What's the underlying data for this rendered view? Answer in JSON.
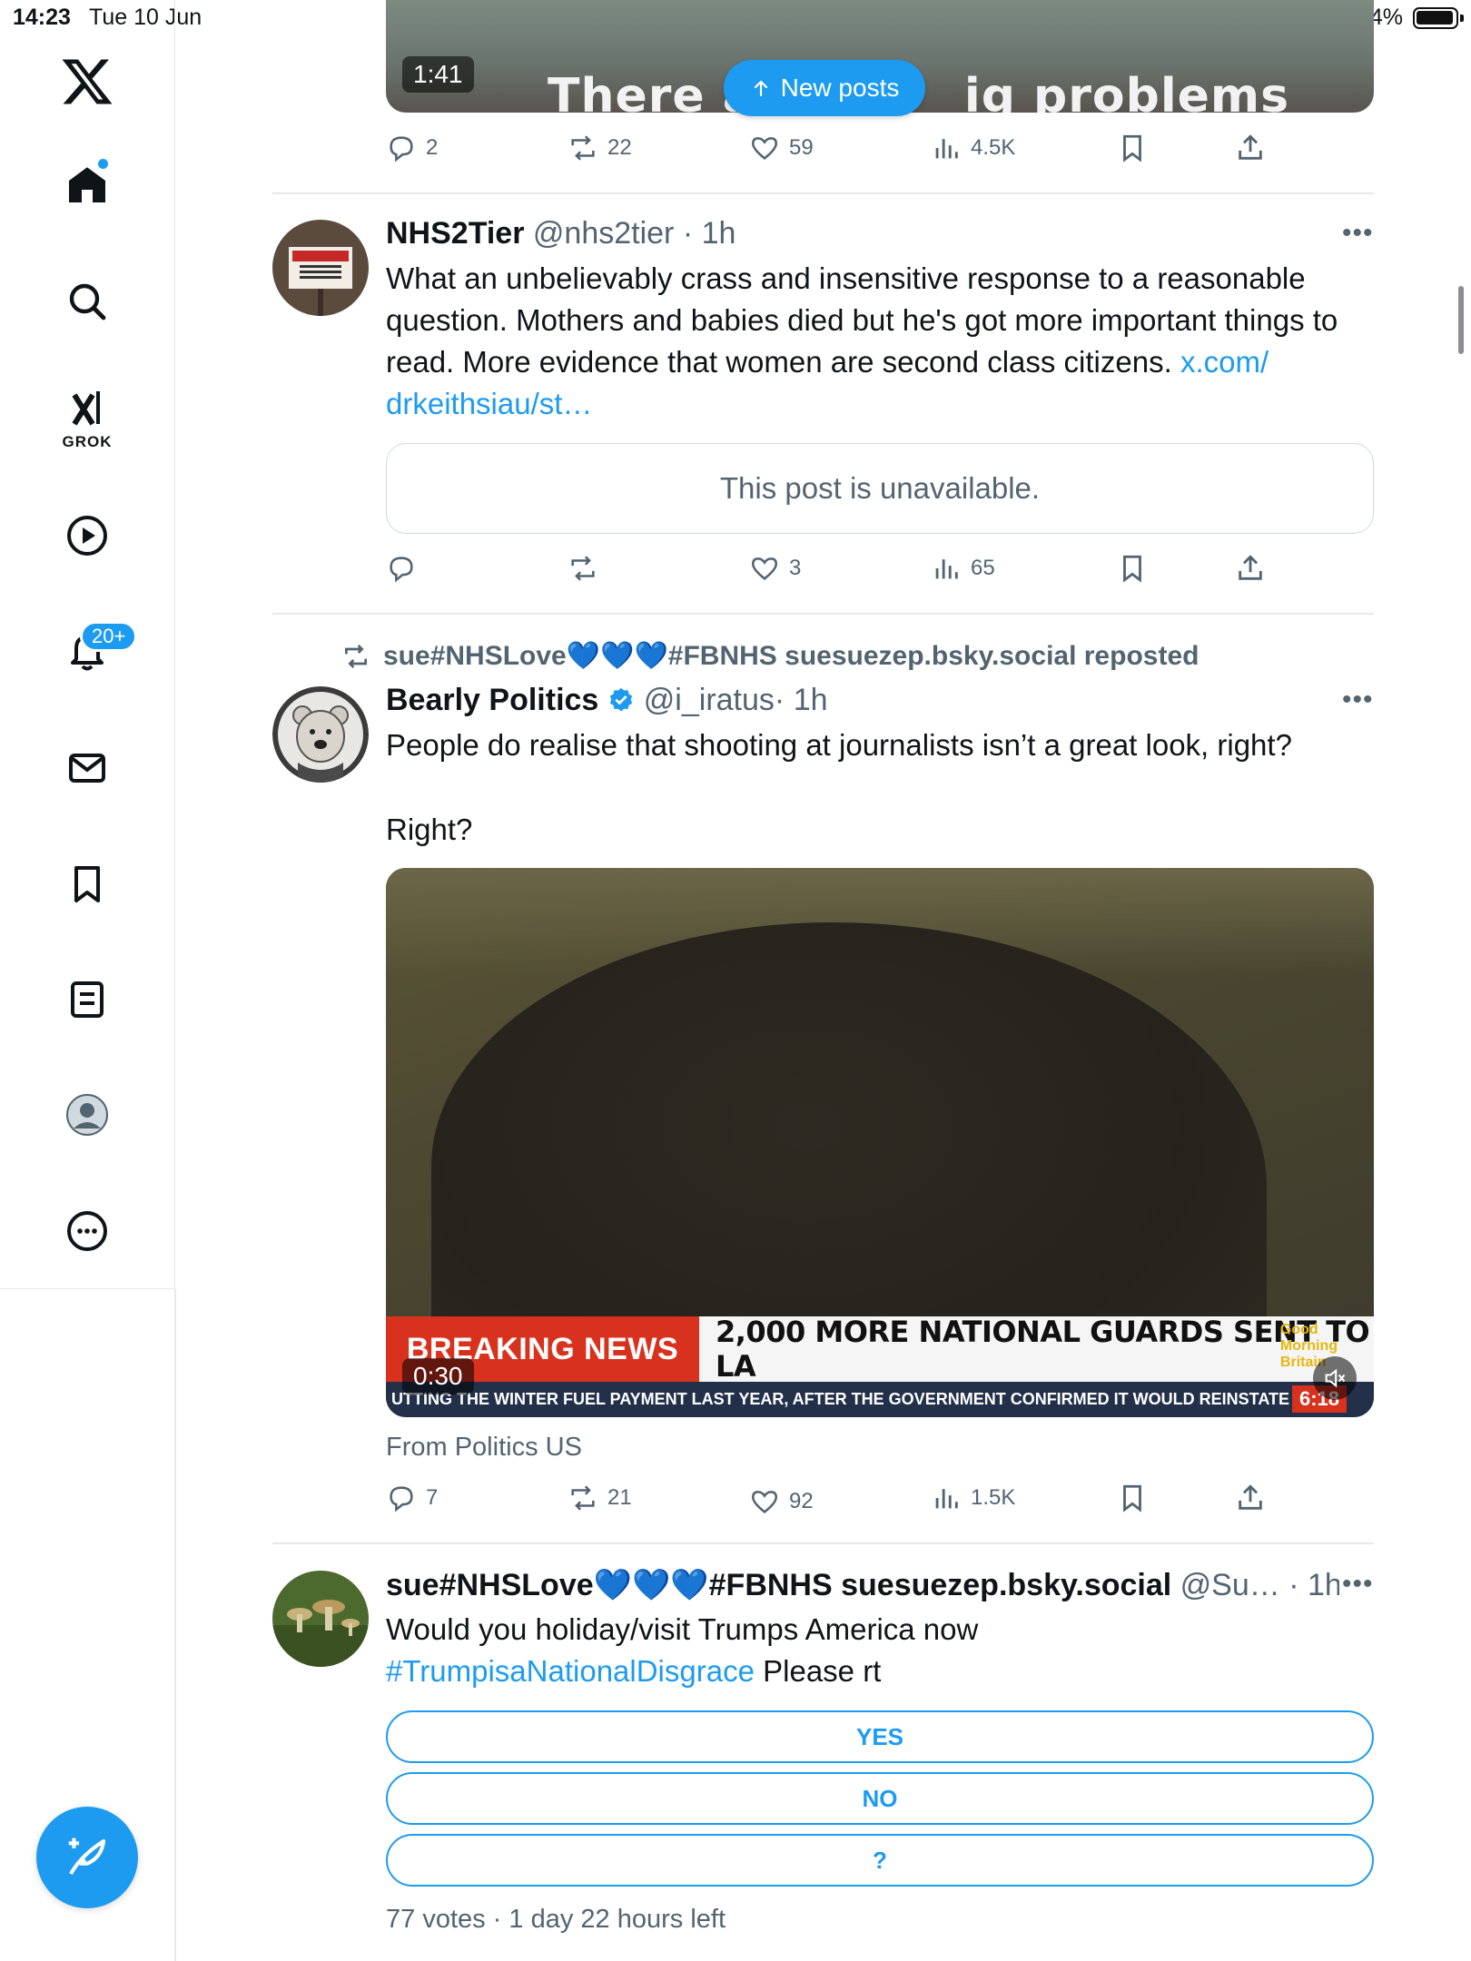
{
  "status_bar": {
    "time": "14:23",
    "date": "Tue 10 Jun",
    "battery": "94%"
  },
  "sidebar": {
    "items": [
      {
        "name": "home",
        "icon": "home-icon"
      },
      {
        "name": "explore",
        "icon": "search-icon"
      },
      {
        "name": "grok",
        "icon": "grok-icon",
        "label": "GROK"
      },
      {
        "name": "video",
        "icon": "play-circle-icon"
      },
      {
        "name": "notifications",
        "icon": "bell-icon",
        "badge": "20+"
      },
      {
        "name": "messages",
        "icon": "mail-icon"
      },
      {
        "name": "bookmarks",
        "icon": "bookmark-icon"
      },
      {
        "name": "lists",
        "icon": "list-icon"
      },
      {
        "name": "profile",
        "icon": "avatar-icon"
      },
      {
        "name": "more",
        "icon": "more-circle-icon"
      }
    ],
    "compose_icon": "compose-icon"
  },
  "new_posts_label": "New posts",
  "top_post": {
    "video_time": "1:41",
    "caption_visible": "There a",
    "caption_visible_2": "ig problems",
    "replies": "2",
    "reposts": "22",
    "likes": "59",
    "views": "4.5K"
  },
  "post1": {
    "name": "NHS2Tier",
    "handle": "@nhs2tier",
    "time": "· 1h",
    "text": "What an unbelievably crass and insensitive response to a reasonable question. Mothers and babies died but he's got more important things to read. More evidence that women are second class citizens.",
    "link_text": "x.com/drkeithsiau/st…",
    "link_part1": "x.com/",
    "link_part2": "drkeithsiau/st…",
    "quote_unavailable": "This post is unavailable.",
    "replies": "",
    "reposts": "",
    "likes": "3",
    "views": "65"
  },
  "post2": {
    "repost_by": "sue#NHSLove💙💙💙#FBNHS suesuezep.bsky.social reposted",
    "name": "Bearly Politics",
    "handle": "@i_iratus",
    "time": "· 1h",
    "text_line1": "People do realise that shooting at journalists isn’t a great look, right?",
    "text_line2": "Right?",
    "video_time": "0:30",
    "chyron_red": "BREAKING NEWS",
    "chyron_white": "2,000 MORE NATIONAL GUARDS SENT TO LA",
    "chyron_brand": "Good Morning Britain",
    "ticker": "UTTING THE WINTER FUEL PAYMENT LAST YEAR, AFTER THE GOVERNMENT CONFIRMED IT WOULD REINSTATE",
    "ticker_clock": "6:18",
    "from": "From Politics US",
    "replies": "7",
    "reposts": "21",
    "likes": "92",
    "views": "1.5K"
  },
  "post3": {
    "name": "sue#NHSLove💙💙💙#FBNHS suesuezep.bsky.social",
    "handle": "@Su…",
    "time": "· 1h",
    "text_line1": "Would you holiday/visit Trumps America now",
    "hashtag": "#TrumpisaNationalDisgrace",
    "text_after": " Please rt",
    "poll_options": [
      "YES",
      "NO",
      "?"
    ],
    "poll_meta": "77 votes · 1 day 22 hours left"
  },
  "colors": {
    "accent": "#1d9bf0",
    "text": "#0f1419",
    "muted": "#536471",
    "border": "#e6e8ea",
    "breaking_red": "#d8321f"
  }
}
